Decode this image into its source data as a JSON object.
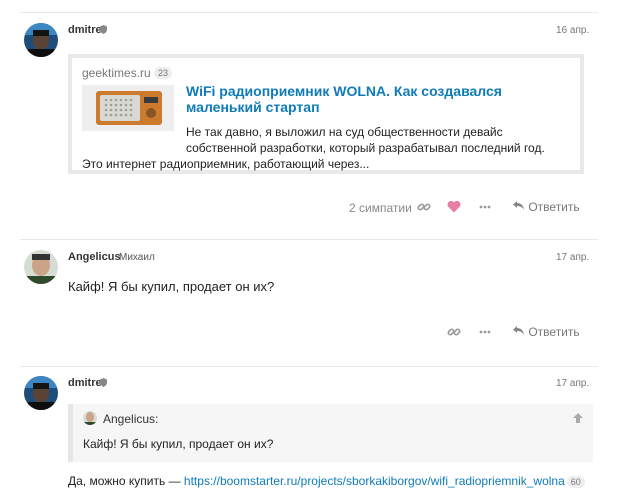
{
  "post1": {
    "username": "dmitre",
    "date": "16 апр.",
    "onebox": {
      "source": "geektimes.ru",
      "count": "23",
      "title": "WiFi радиоприемник WOLNA. Как создавался маленький стартап",
      "excerpt": "Не так давно, я выложил на суд общественности девайс собственной разработки, который разрабатывал последний год.",
      "excerpt_last": "Это интернет радиоприемник, работающий через..."
    },
    "likes": "2 симпатии",
    "reply": "Ответить"
  },
  "post2": {
    "username": "Angelicus",
    "fullname": "Михаил",
    "date": "17 апр.",
    "text": "Кайф! Я бы купил, продает он их?",
    "reply": "Ответить"
  },
  "post3": {
    "username": "dmitre",
    "date": "17 апр.",
    "quote": {
      "author": "Angelicus:",
      "text": "Кайф! Я бы купил, продает он их?"
    },
    "text_prefix": "Да, можно купить — ",
    "link": "https://boomstarter.ru/projects/sborkakiborgov/wifi_radiopriemnik_wolna",
    "link_count": "60"
  },
  "colors": {
    "link": "#0f7bb8",
    "like_heart": "#e87ea3",
    "muted": "#888888"
  },
  "icons": [
    "shield-icon",
    "link-icon",
    "heart-icon",
    "more-icon",
    "reply-icon",
    "arrow-up-icon"
  ]
}
